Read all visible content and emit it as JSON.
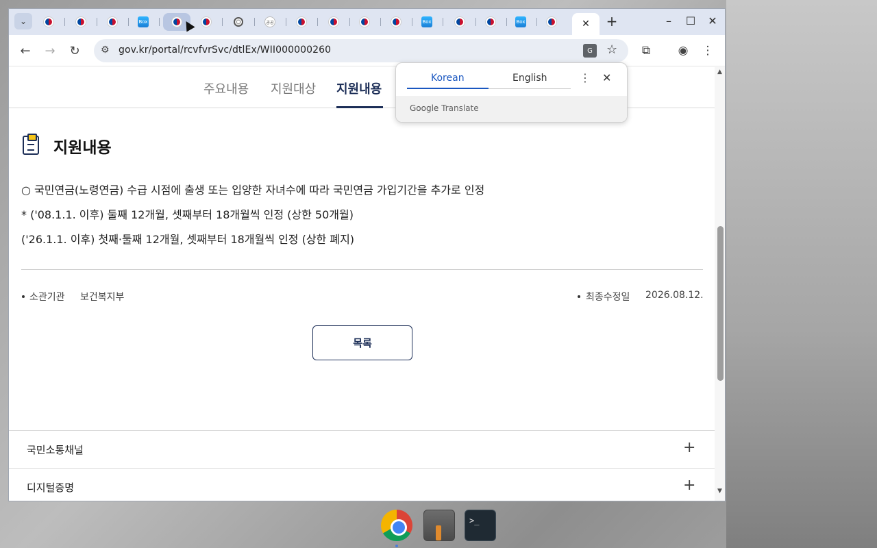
{
  "browser": {
    "url": "gov.kr/portal/rcvfvrSvc/dtlEx/WII000000260",
    "tabs": [
      {
        "icon": "gov-favicon"
      },
      {
        "icon": "gov-favicon"
      },
      {
        "icon": "gov-favicon"
      },
      {
        "icon": "blue-square-favicon"
      },
      {
        "icon": "gov-favicon"
      },
      {
        "icon": "gov-favicon"
      },
      {
        "icon": "globe-favicon"
      },
      {
        "icon": "round-favicon"
      },
      {
        "icon": "gov-favicon"
      },
      {
        "icon": "gov-favicon"
      },
      {
        "icon": "gov-favicon"
      },
      {
        "icon": "gov-favicon"
      },
      {
        "icon": "blue-square-favicon"
      },
      {
        "icon": "gov-favicon"
      },
      {
        "icon": "gov-favicon"
      },
      {
        "icon": "blue-square-favicon"
      },
      {
        "icon": "gov-favicon"
      }
    ],
    "blue_square_favicon_text": "Box",
    "round_favicon_text": "공공"
  },
  "page": {
    "tabs": [
      "주요내용",
      "지원대상",
      "지원내용"
    ],
    "active_tab": "지원내용",
    "section_title": "지원내용",
    "lines": [
      "○ 국민연금(노령연금) 수급 시점에 출생 또는 입양한 자녀수에 따라 국민연금 가입기간을 추가로 인정",
      "* ('08.1.1. 이후) 둘째 12개월, 셋째부터 18개월씩 인정 (상한 50개월)",
      "('26.1.1. 이후) 첫째·둘째 12개월, 셋째부터 18개월씩 인정 (상한 폐지)"
    ],
    "meta": {
      "agency_label": "소관기관",
      "agency_value": "보건복지부",
      "updated_label": "최종수정일",
      "updated_value": "2026.08.12."
    },
    "list_button": "목록",
    "footer_items": [
      "국민소통채널",
      "디지털증명"
    ]
  },
  "translate_popup": {
    "source_lang": "Korean",
    "target_lang": "English",
    "brand_google": "Google",
    "brand_translate": "Translate"
  },
  "taskbar": {
    "terminal_prompt": ">_"
  }
}
